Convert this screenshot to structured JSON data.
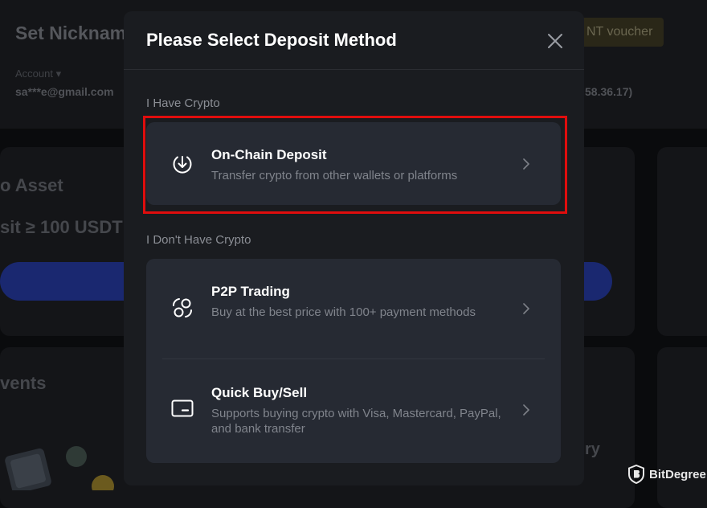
{
  "background": {
    "nickname": "Set Nicknam",
    "voucher": "NT voucher",
    "account_label": "Account ▾",
    "email": "sa***e@gmail.com",
    "ip": "58.36.17)",
    "asset_heading": "o Asset",
    "deposit_heading": "sit ≥ 100 USDT",
    "events_heading": "vents",
    "partial_text": "ry"
  },
  "modal": {
    "title": "Please Select Deposit Method",
    "sections": [
      {
        "label": "I Have Crypto",
        "options": [
          {
            "title": "On-Chain Deposit",
            "description": "Transfer crypto from other wallets or platforms",
            "icon": "download-circle-icon"
          }
        ]
      },
      {
        "label": "I Don't Have Crypto",
        "options": [
          {
            "title": "P2P Trading",
            "description": "Buy at the best price with 100+ payment methods",
            "icon": "p2p-exchange-icon"
          },
          {
            "title": "Quick Buy/Sell",
            "description": "Supports buying crypto with Visa, Mastercard, PayPal, and bank transfer",
            "icon": "credit-card-icon"
          }
        ]
      }
    ]
  },
  "highlight_color": "#e00d0d",
  "watermark": {
    "text": "BitDegree"
  }
}
